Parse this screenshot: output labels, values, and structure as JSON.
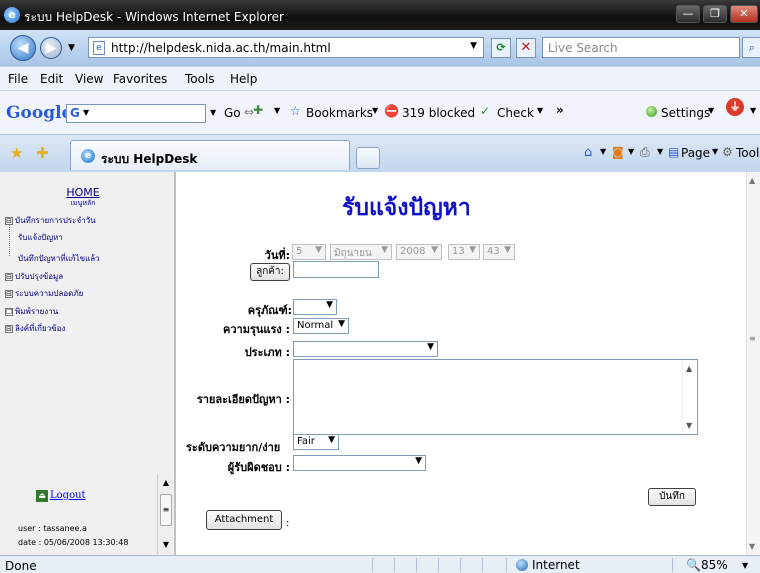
{
  "window": {
    "title": "ระบบ HelpDesk - Windows Internet Explorer",
    "buttons": [
      "—",
      "❐",
      "✕"
    ]
  },
  "address_bar": {
    "url": "http://helpdesk.nida.ac.th/main.html",
    "search_placeholder": "Live Search"
  },
  "menu": [
    "File",
    "Edit",
    "View",
    "Favorites",
    "Tools",
    "Help"
  ],
  "google_toolbar": {
    "logo": "Google",
    "box_logo": "G",
    "go": "Go",
    "bookmarks": "Bookmarks",
    "blocked": "319 blocked",
    "check": "Check",
    "more": "»",
    "settings": "Settings"
  },
  "tab": {
    "label": "ระบบ HelpDesk",
    "page": "Page",
    "tools": "Tools"
  },
  "sidebar": {
    "home": "HOME",
    "main_menu": "เมนูหลัก",
    "tree": [
      {
        "label": "บันทึกรายการประจำวัน",
        "expander": "⊟"
      },
      {
        "label": "รับแจ้งปัญหา",
        "expander": ""
      },
      {
        "label": "บันทึกปัญหาที่แก้ไขแล้ว",
        "expander": ""
      },
      {
        "label": "ปรับปรุงข้อมูล",
        "expander": "⊟"
      },
      {
        "label": "ระบบความปลอดภัย",
        "expander": "⊟"
      },
      {
        "label": "พิมพ์รายงาน",
        "expander": "☐"
      },
      {
        "label": "ลิงค์ที่เกี่ยวข้อง",
        "expander": "⊟"
      }
    ],
    "logout": "Logout",
    "user": "user : tassanee.a",
    "date": "date : 05/06/2008 13:30:48"
  },
  "form": {
    "title": "รับแจ้งปัญหา",
    "date_label": "วันที่:",
    "day": "5",
    "month": "มิถุนายน",
    "year": "2008",
    "hour": "13",
    "minute": "43",
    "customer_button": "ลูกค้า:",
    "equipment_label": "ครุภัณฑ์:",
    "equipment_value": "",
    "severity_label": "ความรุนแรง :",
    "severity_value": "Normal",
    "type_label": "ประเภท :",
    "type_value": "",
    "detail_label": "รายละเอียดปัญหา :",
    "difficulty_label": "ระดับความยาก/ง่าย",
    "difficulty_value": "Fair",
    "responsible_label": "ผู้รับผิดชอบ :",
    "responsible_value": "",
    "save_button": "บันทึก",
    "attachment_button": "Attachment",
    "attachment_suffix": ":"
  },
  "status_bar": {
    "text": "Done",
    "zone": "Internet",
    "zoom": "85%"
  }
}
